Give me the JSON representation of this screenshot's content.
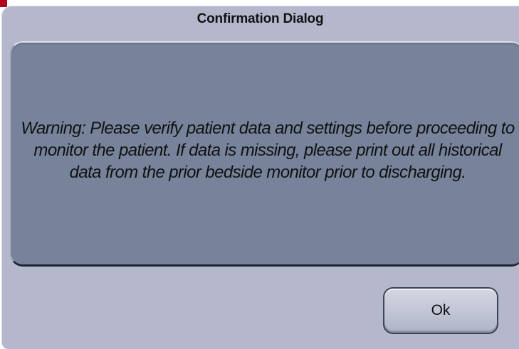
{
  "dialog": {
    "title": "Confirmation Dialog",
    "message": "Warning: Please verify patient data and settings before proceeding to monitor the patient.  If data is missing, please print out all historical data from the prior bedside monitor prior to discharging.",
    "ok_label": "Ok"
  },
  "colors": {
    "dialog_background": "#b5b8cd",
    "message_panel": "#76839a",
    "accent": "#b3001b"
  }
}
